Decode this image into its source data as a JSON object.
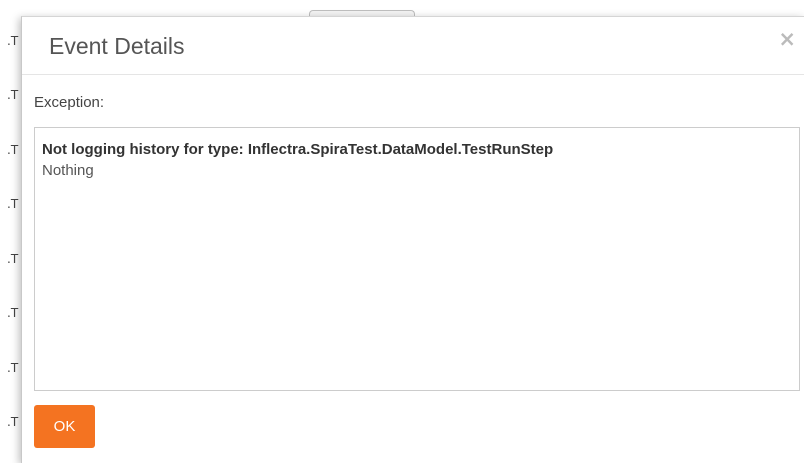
{
  "background": {
    "row_fragments": [
      ".T",
      ".T",
      ".T",
      ".T",
      ".T",
      ".T",
      ".T",
      ".T"
    ]
  },
  "dialog": {
    "title": "Event Details",
    "close_glyph": "×",
    "close_icon": "close-icon",
    "field_label": "Exception:",
    "exception_message": "Not logging history for type: Inflectra.SpiraTest.DataModel.TestRunStep",
    "exception_detail": "Nothing",
    "ok_label": "OK"
  },
  "colors": {
    "accent": "#f47321",
    "title_text": "#555555",
    "close_icon": "#bbbbbb",
    "border": "#cccccc"
  }
}
